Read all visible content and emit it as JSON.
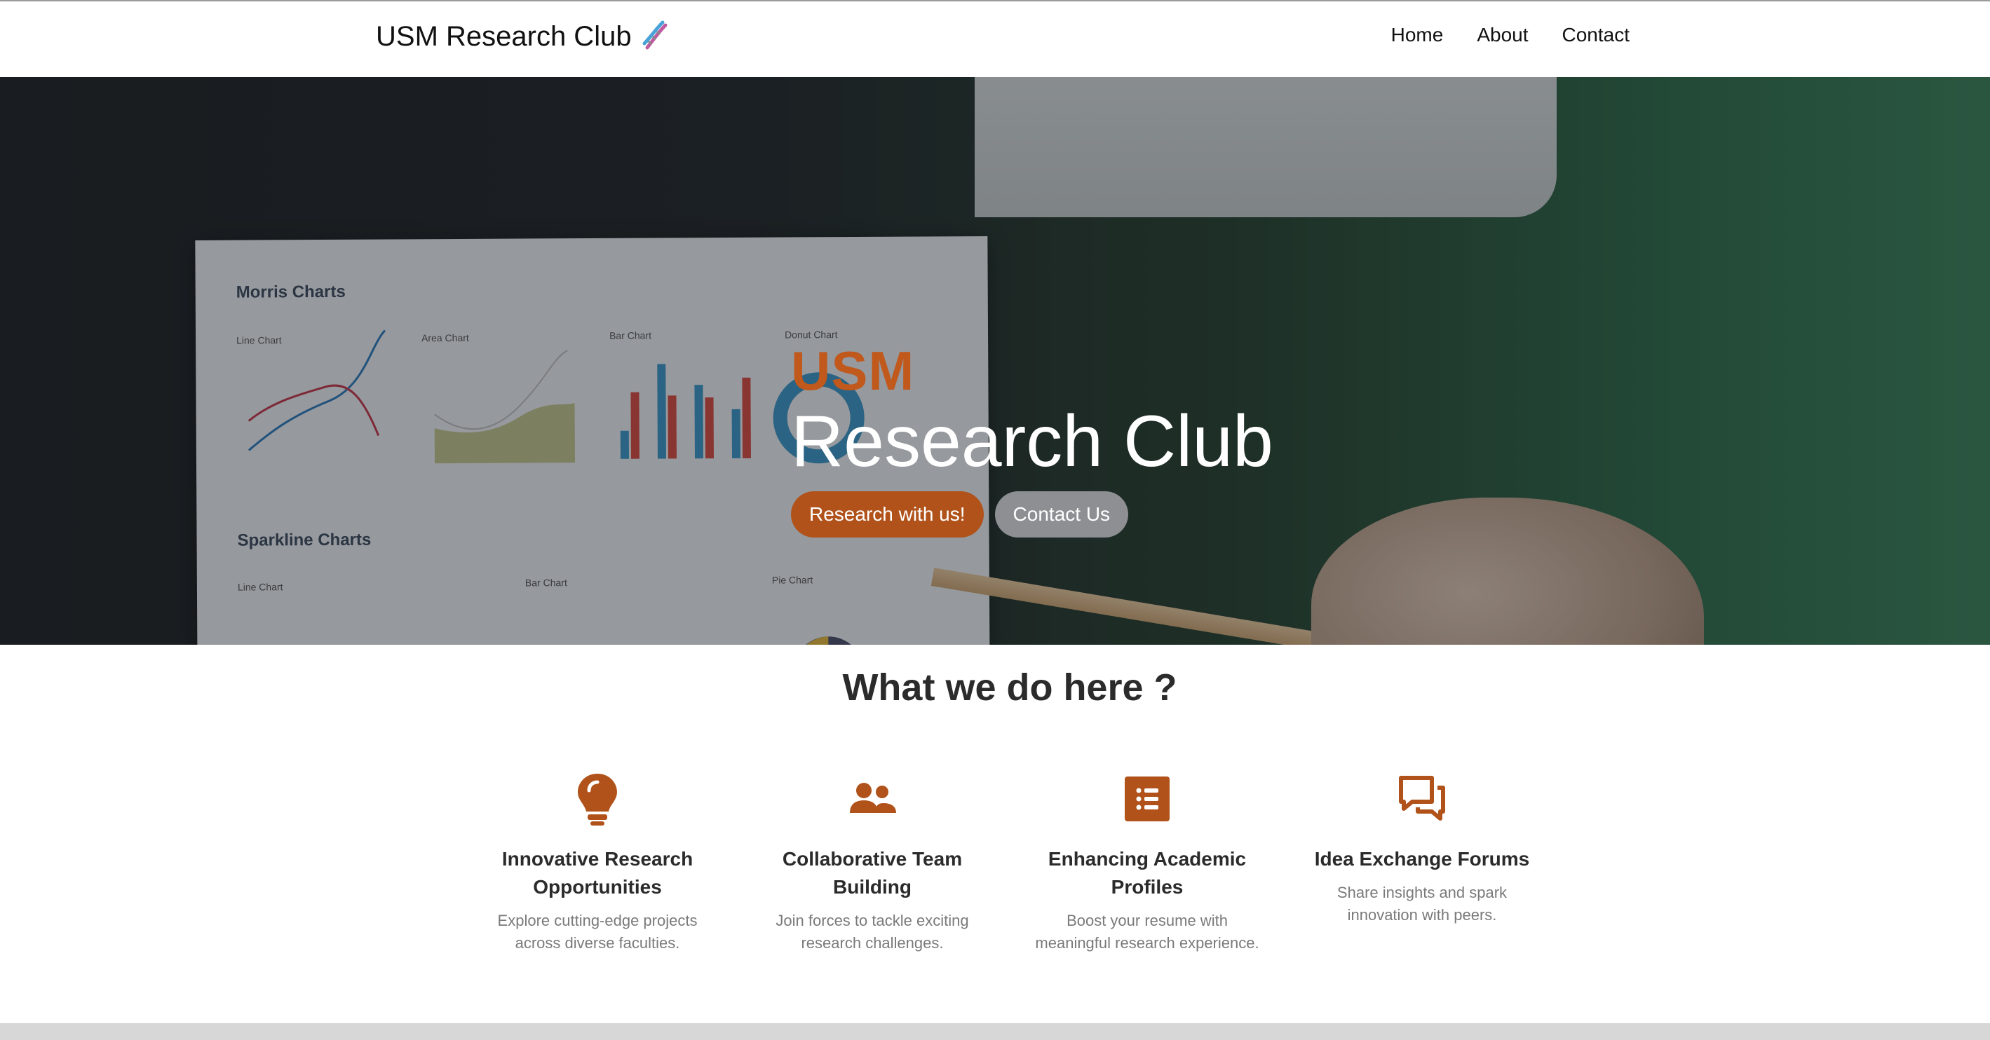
{
  "navbar": {
    "brand": "USM Research Club",
    "brand_icon": "dna-icon",
    "links": [
      "Home",
      "About",
      "Contact"
    ]
  },
  "hero": {
    "usm": "USM",
    "title": "Research Club",
    "primary_button": "Research with us!",
    "secondary_button": "Contact Us",
    "paper_texts": {
      "heading1": "Morris Charts",
      "line_chart": "Line Chart",
      "area_chart": "Area Chart",
      "bar_chart": "Bar Chart",
      "donut_chart": "Donut Chart",
      "heading2": "Sparkline Charts",
      "spark_line": "Line Chart",
      "spark_bar": "Bar Chart",
      "pie_chart": "Pie Chart"
    }
  },
  "section": {
    "title": "What we do here ?"
  },
  "features": [
    {
      "icon": "lightbulb-icon",
      "title_line1": "Innovative Research",
      "title_line2": "Opportunities",
      "text_line1": "Explore cutting-edge projects",
      "text_line2": "across diverse faculties."
    },
    {
      "icon": "team-icon",
      "title_line1": "Collaborative Team",
      "title_line2": "Building",
      "text_line1": "Join forces to tackle exciting",
      "text_line2": "research challenges."
    },
    {
      "icon": "list-icon",
      "title_line1": "Enhancing Academic",
      "title_line2": "Profiles",
      "text_line1": "Boost your resume with",
      "text_line2": "meaningful research experience."
    },
    {
      "icon": "chat-icon",
      "title_line1": "Idea Exchange Forums",
      "title_line2": "",
      "text_line1": "Share insights and spark",
      "text_line2": "innovation with peers."
    }
  ],
  "colors": {
    "accent": "#b05219",
    "usm_orange": "#c1581c",
    "secondary_btn": "#8d8f92"
  }
}
